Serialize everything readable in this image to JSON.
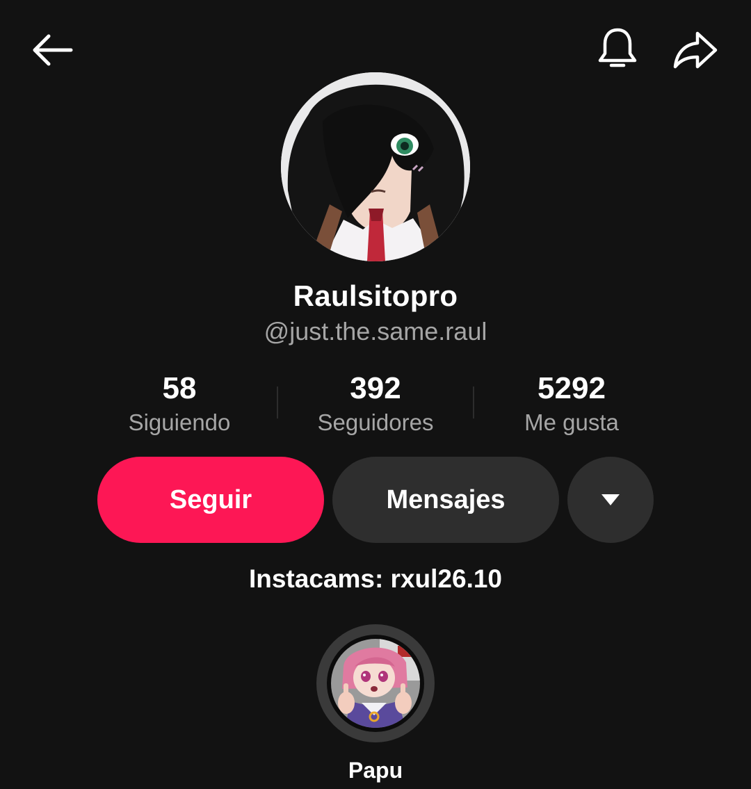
{
  "header": {
    "back_icon": "arrow-left-icon",
    "notification_icon": "bell-icon",
    "share_icon": "share-arrow-icon"
  },
  "profile": {
    "display_name": "Raulsitopro",
    "handle": "@just.the.same.raul",
    "bio": "Instacams: rxul26.10"
  },
  "stats": [
    {
      "value": "58",
      "label": "Siguiendo"
    },
    {
      "value": "392",
      "label": "Seguidores"
    },
    {
      "value": "5292",
      "label": "Me gusta"
    }
  ],
  "actions": {
    "follow_label": "Seguir",
    "messages_label": "Mensajes",
    "more_icon": "caret-down-icon"
  },
  "highlights": [
    {
      "label": "Papu"
    }
  ],
  "colors": {
    "background": "#121212",
    "follow_button": "#fd1755",
    "secondary_button": "#2e2e2e",
    "muted_text": "#a6a6a6"
  }
}
